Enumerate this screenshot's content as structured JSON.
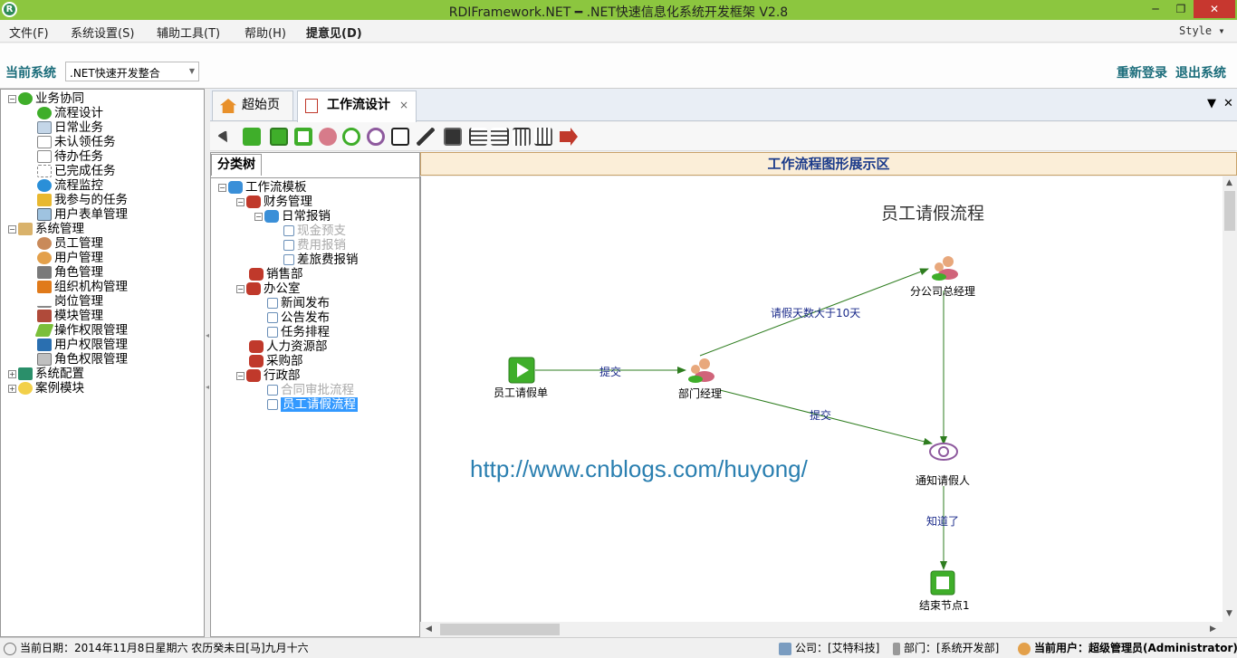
{
  "window": {
    "title": "RDIFramework.NET ━ .NET快速信息化系统开发框架 V2.8",
    "min": "─",
    "max": "❐",
    "close": "✕"
  },
  "menu": {
    "file": "文件(F)",
    "settings": "系统设置(S)",
    "tools": "辅助工具(T)",
    "help": "帮助(H)",
    "feedback": "提意见(D)",
    "style": "Style ▾"
  },
  "system": {
    "label": "当前系统",
    "current": ".NET快速开发整合",
    "relogin": "重新登录",
    "logout": "退出系统"
  },
  "nav": {
    "group1": {
      "label": "业务协同",
      "items": [
        "流程设计",
        "日常业务",
        "未认领任务",
        "待办任务",
        "已完成任务",
        "流程监控",
        "我参与的任务",
        "用户表单管理"
      ]
    },
    "group2": {
      "label": "系统管理",
      "items": [
        "员工管理",
        "用户管理",
        "角色管理",
        "组织机构管理",
        "岗位管理",
        "模块管理",
        "操作权限管理",
        "用户权限管理",
        "角色权限管理"
      ]
    },
    "group3": {
      "label": "系统配置"
    },
    "group4": {
      "label": "案例模块"
    }
  },
  "tabs": {
    "home": "超始页",
    "workflow": "工作流设计",
    "close": "×"
  },
  "category": {
    "tab": "分类树",
    "root": "工作流模板",
    "finance": "财务管理",
    "daily": "日常报销",
    "cash": "现金预支",
    "expense": "费用报销",
    "travel": "差旅费报销",
    "sales": "销售部",
    "office": "办公室",
    "news": "新闻发布",
    "notice": "公告发布",
    "schedule": "任务排程",
    "hr": "人力资源部",
    "purchase": "采购部",
    "admin": "行政部",
    "contract": "合同审批流程",
    "leave": "员工请假流程"
  },
  "diagram": {
    "header": "工作流程图形展示区",
    "title": "员工请假流程",
    "watermark": "http://www.cnblogs.com/huyong/",
    "nodes": {
      "start": "员工请假单",
      "dept": "部门经理",
      "branch": "分公司总经理",
      "notify": "通知请假人",
      "end": "结束节点1"
    },
    "edges": {
      "submit1": "提交",
      "over10": "请假天数大于10天",
      "submit2": "提交",
      "known": "知道了"
    }
  },
  "status": {
    "date": "当前日期：2014年11月8日星期六 农历癸未日[马]九月十六",
    "company": "公司：[艾特科技]",
    "dept": "部门：[系统开发部]",
    "user": "当前用户：超级管理员(Administrator)"
  },
  "colors": {
    "titlebar": "#8cc63f",
    "accent": "#1a6c7a",
    "node_green": "#3fae2a",
    "edge_green": "#2e7d1f",
    "selection": "#3399ff"
  }
}
